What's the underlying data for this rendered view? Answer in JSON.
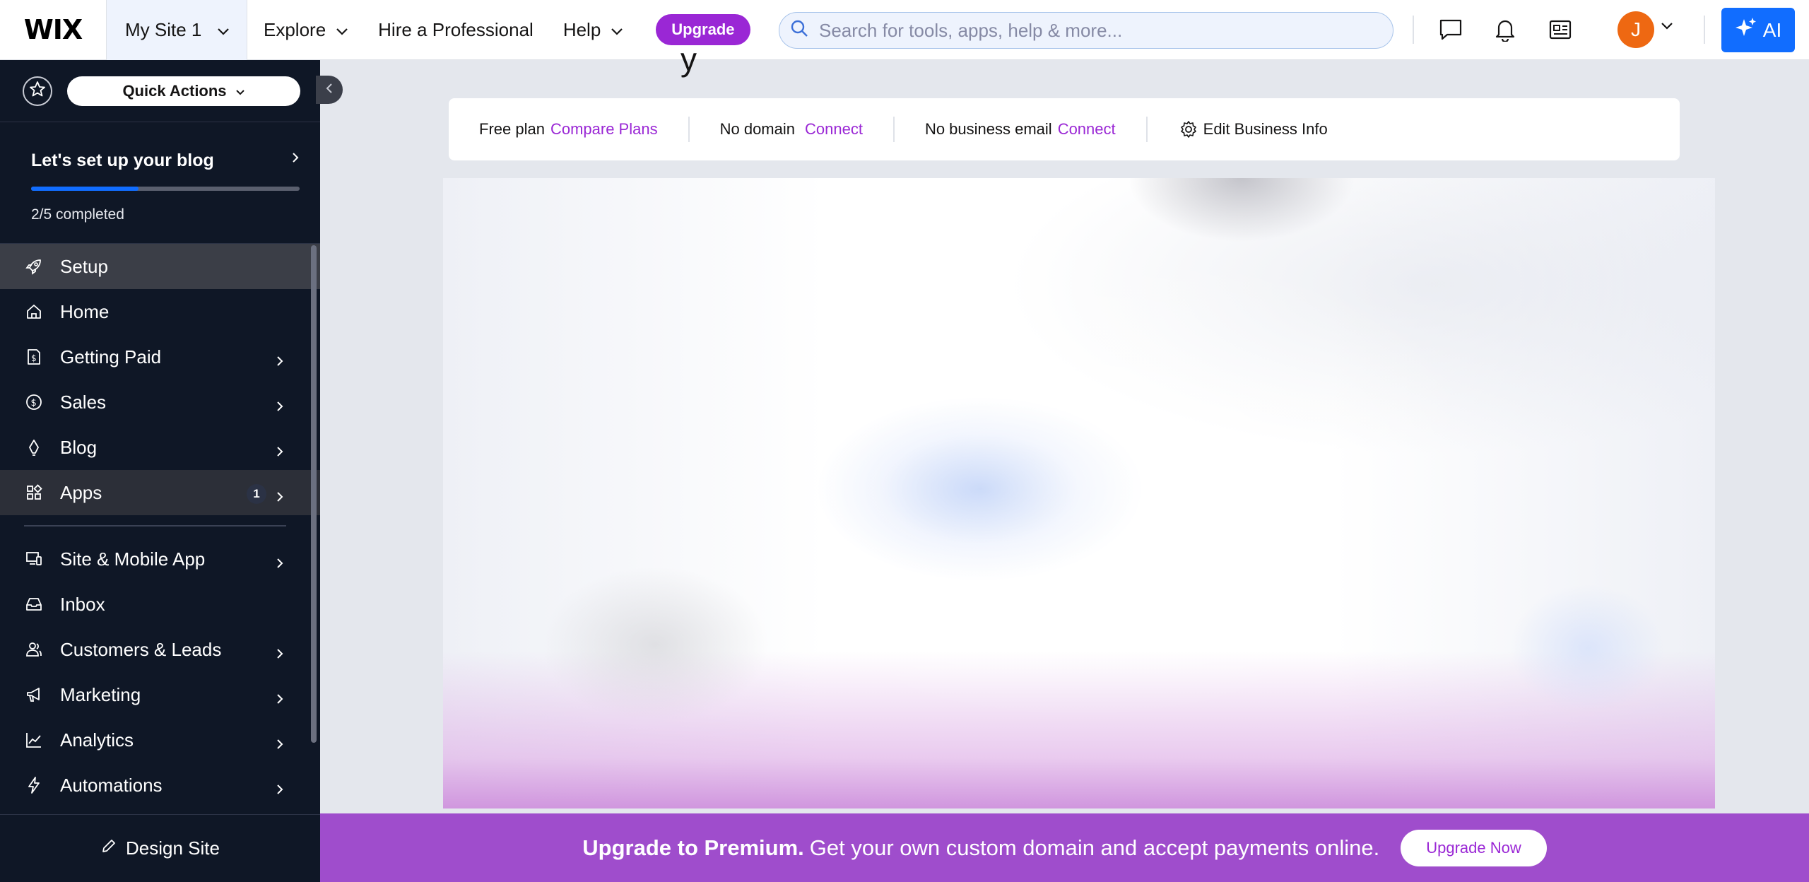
{
  "header": {
    "logo": "WIX",
    "site_name": "My Site 1",
    "nav": {
      "explore": "Explore",
      "hire": "Hire a Professional",
      "help": "Help"
    },
    "upgrade_label": "Upgrade",
    "search_placeholder": "Search for tools, apps, help & more...",
    "avatar_initial": "J",
    "ai_label": "AI",
    "icons": [
      "chat-icon",
      "bell-icon",
      "news-icon",
      "chevron-down-icon",
      "sparkle-icon"
    ]
  },
  "sidebar": {
    "quick_actions_label": "Quick Actions",
    "setup": {
      "title": "Let's set up your blog",
      "status": "2/5 completed",
      "progress": 0.4
    },
    "items": [
      {
        "label": "Setup",
        "icon": "rocket-icon"
      },
      {
        "label": "Home",
        "icon": "home-icon"
      },
      {
        "label": "Getting Paid",
        "icon": "invoice-icon"
      },
      {
        "label": "Sales",
        "icon": "dollar-icon"
      },
      {
        "label": "Blog",
        "icon": "pen-nib-icon"
      },
      {
        "label": "Apps",
        "icon": "apps-icon",
        "badge": "1"
      },
      {
        "label": "Site & Mobile App",
        "icon": "devices-icon"
      },
      {
        "label": "Inbox",
        "icon": "inbox-icon"
      },
      {
        "label": "Customers & Leads",
        "icon": "people-icon"
      },
      {
        "label": "Marketing",
        "icon": "megaphone-icon"
      },
      {
        "label": "Analytics",
        "icon": "chart-line-icon"
      },
      {
        "label": "Automations",
        "icon": "lightning-icon"
      }
    ],
    "design_site_label": "Design Site"
  },
  "main": {
    "title_fragment": "y",
    "info_strip": {
      "plan_text": "Free plan",
      "plan_link": "Compare Plans",
      "domain_text": "No domain",
      "domain_link": "Connect",
      "email_text": "No business email",
      "email_link": "Connect",
      "edit_label": "Edit Business Info"
    }
  },
  "banner": {
    "strong": "Upgrade to Premium.",
    "text": "Get your own custom domain and accept payments online.",
    "button": "Upgrade Now"
  },
  "colors": {
    "accent_purple": "#9a27d5",
    "wix_blue": "#116dff",
    "sidebar_bg": "#0f1726",
    "banner_bg": "#9f4dcc",
    "avatar": "#ee6812"
  }
}
